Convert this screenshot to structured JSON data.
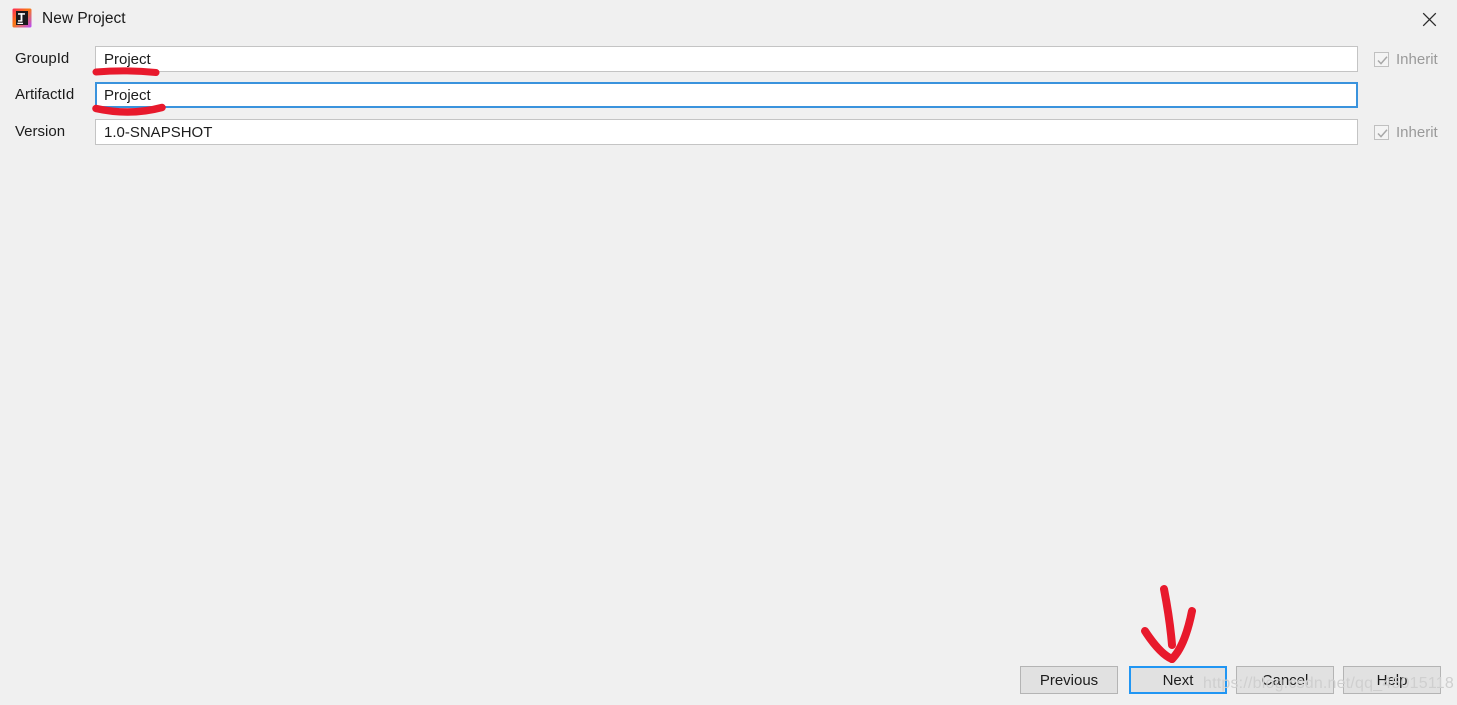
{
  "window": {
    "title": "New Project",
    "icon": "intellij-idea-icon",
    "close_icon": "close-icon",
    "background_color": "#f0f0f0"
  },
  "form": {
    "rows": [
      {
        "label": "GroupId",
        "value": "Project",
        "focused": false,
        "inherit": {
          "label": "Inherit",
          "checked": true,
          "disabled": true
        }
      },
      {
        "label": "ArtifactId",
        "value": "Project",
        "focused": true,
        "inherit": null
      },
      {
        "label": "Version",
        "value": "1.0-SNAPSHOT",
        "focused": false,
        "inherit": {
          "label": "Inherit",
          "checked": true,
          "disabled": true
        }
      }
    ]
  },
  "buttons": {
    "previous": "Previous",
    "next": "Next",
    "cancel": "Cancel",
    "help": "Help",
    "focused": "Next"
  },
  "watermark": {
    "text": "https://blog.csdn.net/qq_45015118"
  },
  "annotations": {
    "color": "#e8192c",
    "items": [
      {
        "name": "groupid-underline",
        "type": "underline"
      },
      {
        "name": "artifactid-underline",
        "type": "underline"
      },
      {
        "name": "next-button-arrow",
        "type": "arrow"
      }
    ]
  },
  "colors": {
    "focus_blue": "#2196f3",
    "field_border": "#c4c4c4",
    "button_face": "#e1e1e1",
    "disabled_text": "#9a9a9a"
  }
}
